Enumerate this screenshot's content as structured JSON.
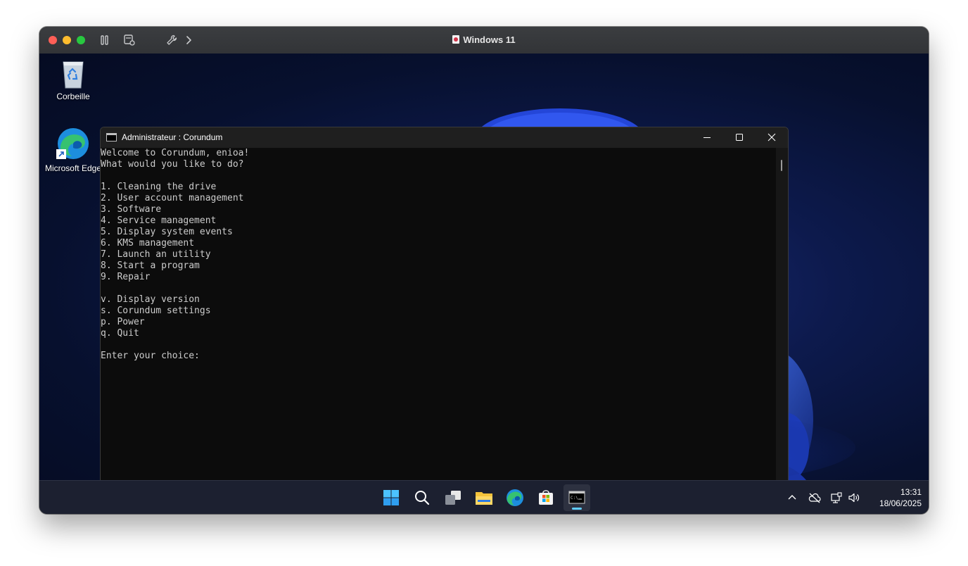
{
  "mac_window": {
    "title": "Windows 11"
  },
  "desktop": {
    "icons": [
      {
        "label": "Corbeille"
      },
      {
        "label": "Microsoft Edge"
      }
    ]
  },
  "console": {
    "title": "Administrateur : Corundum",
    "lines": [
      "Welcome to Corundum, enioa!",
      "What would you like to do?",
      "",
      "1. Cleaning the drive",
      "2. User account management",
      "3. Software",
      "4. Service management",
      "5. Display system events",
      "6. KMS management",
      "7. Launch an utility",
      "8. Start a program",
      "9. Repair",
      "",
      "v. Display version",
      "s. Corundum settings",
      "p. Power",
      "q. Quit",
      "",
      "Enter your choice: "
    ]
  },
  "taskbar": {
    "apps": [
      "start-icon",
      "search-icon",
      "task-view-icon",
      "file-explorer-icon",
      "edge-icon",
      "store-icon",
      "terminal-icon"
    ],
    "active_app": "terminal-icon"
  },
  "tray": {
    "time": "13:31",
    "date": "18/06/2025"
  },
  "colors": {
    "console_bg": "#0c0c0c",
    "console_text": "#cccccc",
    "taskbar_bg": "#1c2030",
    "accent": "#60cdff"
  }
}
